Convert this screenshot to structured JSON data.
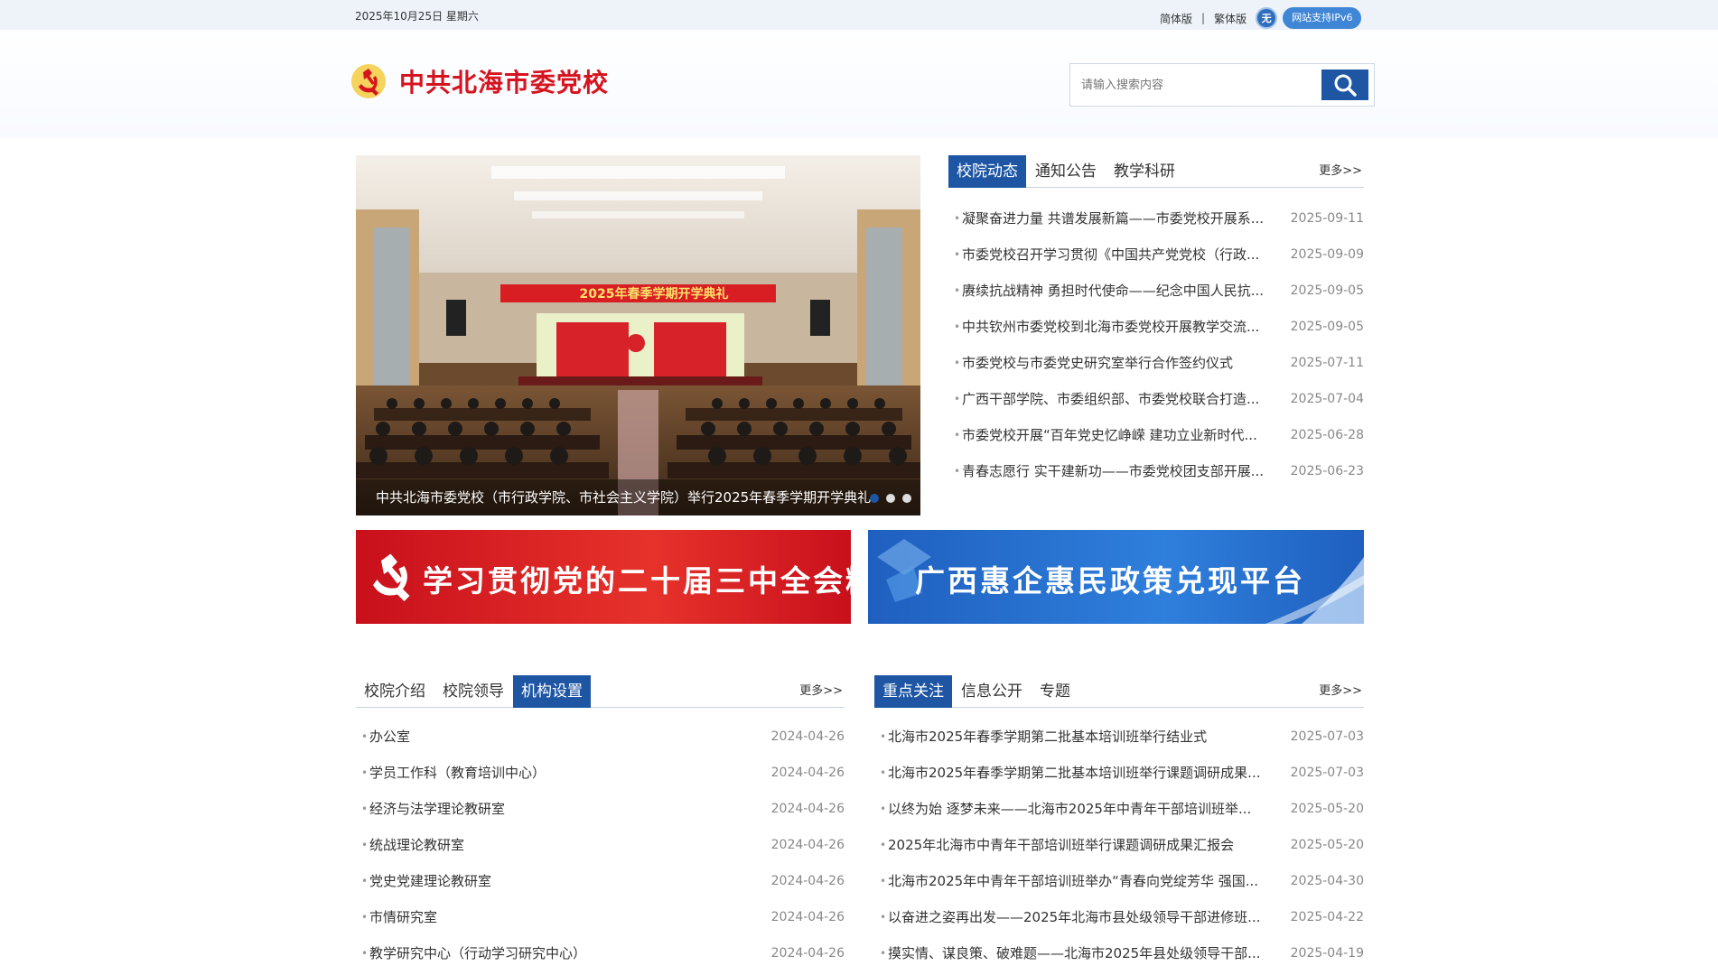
{
  "topbar": {
    "date": "2025年10月25日 星期六",
    "simplified": "简体版",
    "traditional": "繁体版",
    "access_icon": "无",
    "ipv6": "网站支持IPv6"
  },
  "header": {
    "logo_text": "中共北海市委党校",
    "search_placeholder": "请输入搜索内容"
  },
  "carousel": {
    "banner_text": "2025年春季学期开学典礼",
    "caption": "中共北海市委党校（市行政学院、市社会主义学院）举行2025年春季学期开学典礼",
    "dots": 3,
    "active_dot": 0
  },
  "news_panel": {
    "tabs": [
      "校院动态",
      "通知公告",
      "教学科研"
    ],
    "active_tab": 0,
    "more": "更多>>",
    "items": [
      {
        "title": "凝聚奋进力量 共谱发展新篇——市委党校开展系...",
        "date": "2025-09-11"
      },
      {
        "title": "市委党校召开学习贯彻《中国共产党党校（行政...",
        "date": "2025-09-09"
      },
      {
        "title": "赓续抗战精神 勇担时代使命——纪念中国人民抗...",
        "date": "2025-09-05"
      },
      {
        "title": "中共钦州市委党校到北海市委党校开展教学交流...",
        "date": "2025-09-05"
      },
      {
        "title": "市委党校与市委党史研究室举行合作签约仪式",
        "date": "2025-07-11"
      },
      {
        "title": "广西干部学院、市委组织部、市委党校联合打造...",
        "date": "2025-07-04"
      },
      {
        "title": "市委党校开展“百年党史忆峥嵘 建功立业新时代...",
        "date": "2025-06-28"
      },
      {
        "title": "青春志愿行 实干建新功——市委党校团支部开展...",
        "date": "2025-06-23"
      }
    ]
  },
  "banners": {
    "left": "学习贯彻党的二十届三中全会精神",
    "right": "广西惠企惠民政策兑现平台"
  },
  "school_panel": {
    "tabs": [
      "校院介绍",
      "校院领导",
      "机构设置"
    ],
    "active_tab": 2,
    "more": "更多>>",
    "items": [
      {
        "title": "办公室",
        "date": "2024-04-26"
      },
      {
        "title": "学员工作科（教育培训中心）",
        "date": "2024-04-26"
      },
      {
        "title": "经济与法学理论教研室",
        "date": "2024-04-26"
      },
      {
        "title": "统战理论教研室",
        "date": "2024-04-26"
      },
      {
        "title": "党史党建理论教研室",
        "date": "2024-04-26"
      },
      {
        "title": "市情研究室",
        "date": "2024-04-26"
      },
      {
        "title": "教学研究中心（行动学习研究中心）",
        "date": "2024-04-26"
      }
    ]
  },
  "focus_panel": {
    "tabs": [
      "重点关注",
      "信息公开",
      "专题"
    ],
    "active_tab": 0,
    "more": "更多>>",
    "items": [
      {
        "title": "北海市2025年春季学期第二批基本培训班举行结业式",
        "date": "2025-07-03"
      },
      {
        "title": "北海市2025年春季学期第二批基本培训班举行课题调研成果...",
        "date": "2025-07-03"
      },
      {
        "title": "以终为始 逐梦未来——北海市2025年中青年干部培训班举...",
        "date": "2025-05-20"
      },
      {
        "title": "2025年北海市中青年干部培训班举行课题调研成果汇报会",
        "date": "2025-05-20"
      },
      {
        "title": "北海市2025年中青年干部培训班举办“青春向党绽芳华 强国...",
        "date": "2025-04-30"
      },
      {
        "title": "以奋进之姿再出发——2025年北海市县处级领导干部进修班...",
        "date": "2025-04-22"
      },
      {
        "title": "摸实情、谋良策、破难题——北海市2025年县处级领导干部...",
        "date": "2025-04-19"
      }
    ]
  }
}
